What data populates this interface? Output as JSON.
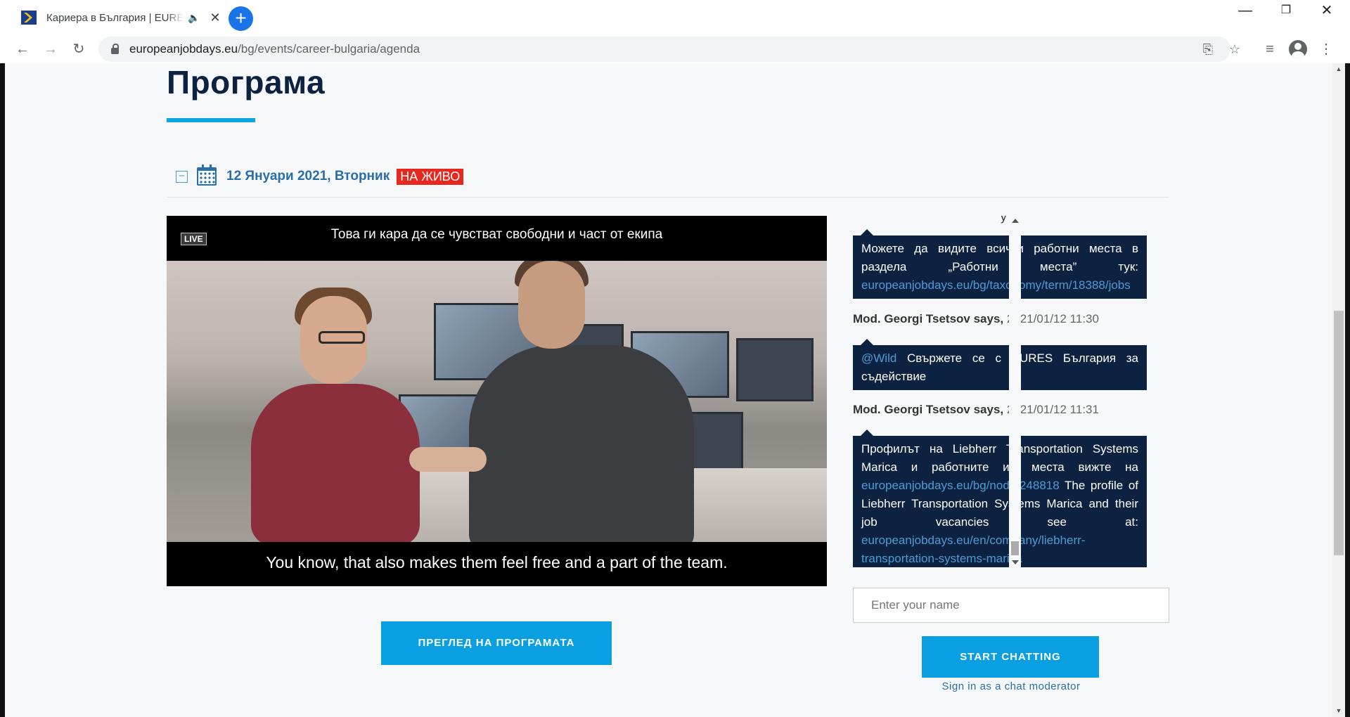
{
  "browser": {
    "tab_title": "Кариера в България | EURES",
    "tab_audio_icon": "speaker-icon",
    "tab_close": "✕",
    "new_tab": "+",
    "window": {
      "minimize": "—",
      "restore": "❐",
      "close": "✕"
    },
    "url_host": "europeanjobdays.eu",
    "url_path": "/bg/events/career-bulgaria/agenda"
  },
  "page": {
    "heading": "Програма",
    "day_label": "12 Януари 2021, Вторник",
    "live_badge": "НА ЖИВО",
    "collapse_symbol": "−",
    "video": {
      "live_tag": "LIVE",
      "subtitle_top": "Това ги кара да се чувстват свободни и част от екипа",
      "subtitle_bottom": "You know, that also makes them feel free and a part of the team."
    },
    "program_button": "ПРЕГЛЕД НА ПРОГРАМАТА"
  },
  "chat": {
    "cut_off_header": "у ,",
    "messages": [
      {
        "text": "Можете да видите всички работни места в раздела „Работни места” тук: ",
        "link": "europeanjobdays.eu/bg/taxonomy/term/18388/jobs"
      },
      {
        "author": "Mod. Georgi Tsetsov says,",
        "time": "2021/01/12 11:30",
        "mention": "@Wild",
        "text": " Свържете се с EURES България за съдействие"
      },
      {
        "author": "Mod. Georgi Tsetsov says,",
        "time": "2021/01/12 11:31",
        "text_a": "Профилът на Liebherr Transportation Systems Marica и работните им места вижте на ",
        "link_a": "europeanjobdays.eu/bg/node/248818",
        "text_b": " The profile of Liebherr Transportation Systems Marica and their job vacancies see at: ",
        "link_b": "europeanjobdays.eu/en/company/liebherr-transportation-systems-marica"
      }
    ],
    "name_placeholder": "Enter your name",
    "start_button": "START CHATTING",
    "moderator_link": "Sign in as a chat moderator"
  },
  "colors": {
    "navy": "#0d2240",
    "accent_blue": "#0a9fe0",
    "link_blue": "#4d9bd6",
    "live_red": "#e8271e"
  }
}
